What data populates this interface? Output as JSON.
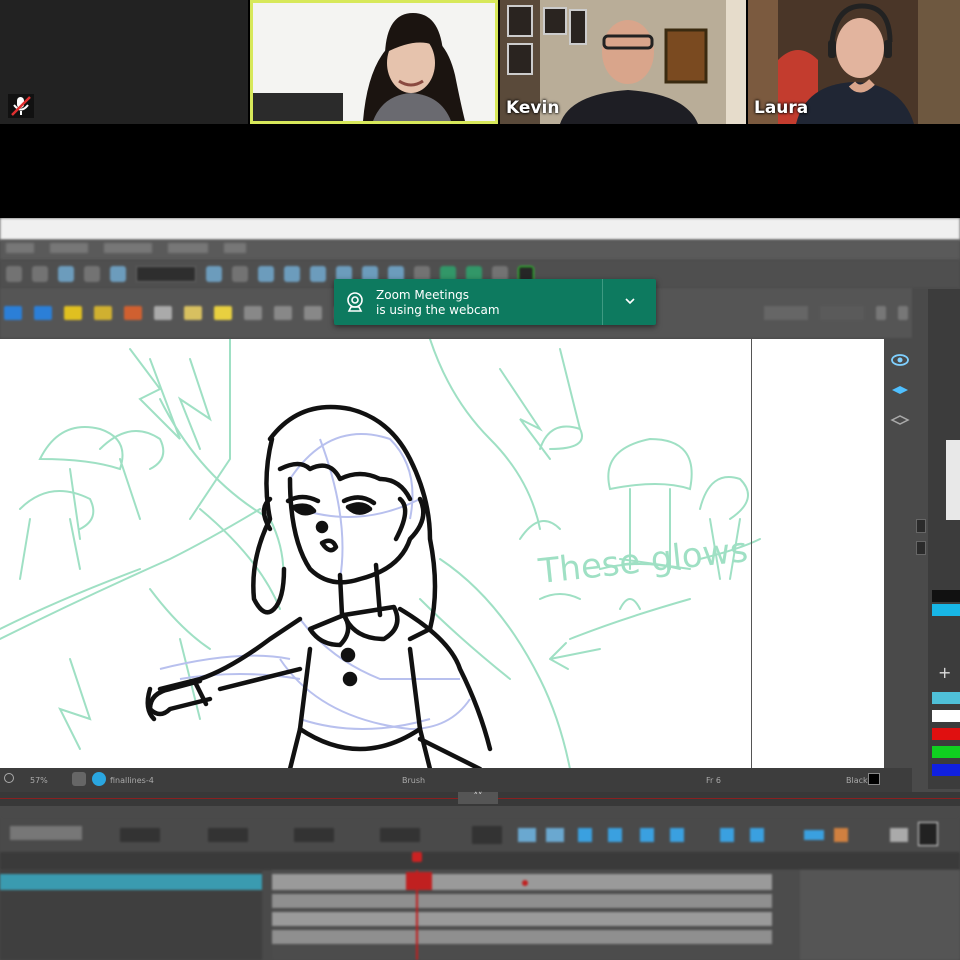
{
  "participants": [
    {
      "name": "",
      "muted": true
    },
    {
      "name": ""
    },
    {
      "name": "Kevin"
    },
    {
      "name": "Laura"
    }
  ],
  "notification": {
    "app": "Zoom Meetings",
    "message": "is using the webcam"
  },
  "canvas": {
    "annotation": "These glows"
  },
  "status_bar": {
    "zoom": "57%",
    "layer": "finallines-4",
    "tool": "Brush",
    "frame": "Fr 6",
    "color": "Black"
  },
  "colors": {
    "notification_bg": "#0d7a5f",
    "active_speaker_border": "#d7e85a",
    "sketch_line": "#111111",
    "rough_green": "#9fe0c4",
    "rough_blue": "#b8c0ee",
    "playhead": "#cc2222"
  }
}
